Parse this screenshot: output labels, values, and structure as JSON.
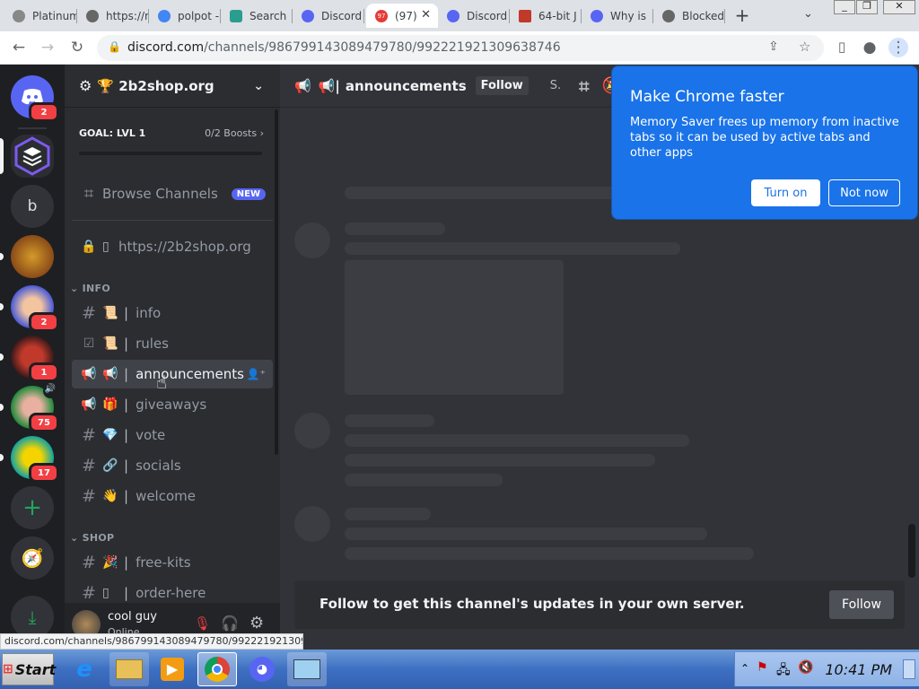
{
  "browser": {
    "tabs": [
      {
        "title": "Platinum",
        "color": "#888"
      },
      {
        "title": "https://m",
        "color": "#666"
      },
      {
        "title": "polpot -",
        "color": "#4285f4"
      },
      {
        "title": "Search",
        "color": "#2a9d8f"
      },
      {
        "title": "Discord",
        "color": "#5865f2"
      },
      {
        "title": "(97)",
        "color": "#e53935",
        "badge": "97"
      },
      {
        "title": "Discord",
        "color": "#5865f2"
      },
      {
        "title": "64-bit J",
        "color": "#c0392b"
      },
      {
        "title": "Why is",
        "color": "#5865f2"
      },
      {
        "title": "Blocked",
        "color": "#666"
      }
    ],
    "url_domain": "discord.com",
    "url_path": "/channels/986799143089479780/992221921309638746",
    "status_url": "discord.com/channels/986799143089479780/992221921309638..."
  },
  "discord": {
    "servers": [
      {
        "label": "",
        "badge": "2"
      },
      {
        "label": "",
        "badge": ""
      },
      {
        "label": "b",
        "badge": ""
      },
      {
        "label": "",
        "badge": ""
      },
      {
        "label": "",
        "badge": "2"
      },
      {
        "label": "",
        "badge": "1"
      },
      {
        "label": "",
        "badge": "75"
      },
      {
        "label": "",
        "badge": "17"
      }
    ],
    "guild_name": "🏆 2b2shop.org",
    "boost_goal": "GOAL: LVL 1",
    "boost_count": "0/2 Boosts",
    "browse_channels": "Browse Channels",
    "new_badge": "NEW",
    "link_channel": "https://2b2shop.org",
    "category_info": "INFO",
    "category_shop": "SHOP",
    "info_channels": [
      {
        "emoji": "📜",
        "name": "info"
      },
      {
        "emoji": "📜",
        "name": "rules"
      },
      {
        "emoji": "📢",
        "name": "announcements"
      },
      {
        "emoji": "🎁",
        "name": "giveaways"
      },
      {
        "emoji": "💎",
        "name": "vote"
      },
      {
        "emoji": "🔗",
        "name": "socials"
      },
      {
        "emoji": "👋",
        "name": "welcome"
      }
    ],
    "shop_channels": [
      {
        "emoji": "🎉",
        "name": "free-kits"
      },
      {
        "emoji": "▯",
        "name": "order-here"
      }
    ],
    "user_name": "cool guy",
    "user_status": "Online",
    "channel_header": "announcements",
    "header_follow": "Follow",
    "header_search_short": "S.",
    "follow_message": "Follow to get this channel's updates in your own server.",
    "follow_button": "Follow"
  },
  "popup": {
    "title": "Make Chrome faster",
    "body": "Memory Saver frees up memory from inactive tabs so it can be used by active tabs and other apps",
    "turn_on": "Turn on",
    "not_now": "Not now"
  },
  "taskbar": {
    "start": "Start",
    "clock": "10:41 PM"
  }
}
